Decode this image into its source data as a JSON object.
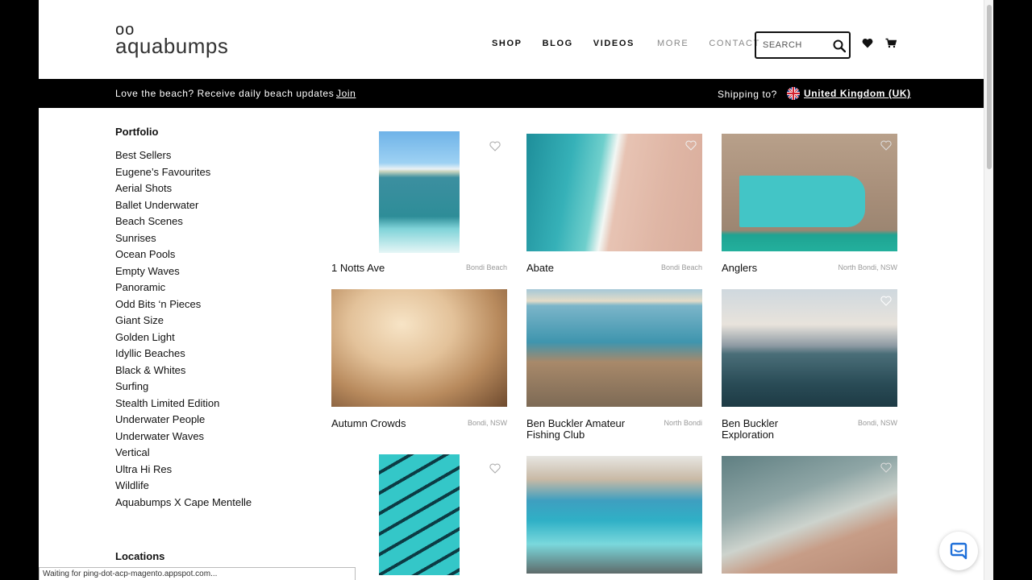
{
  "header": {
    "logo_dots": "oo",
    "logo_word": "aquabumps",
    "nav": [
      {
        "label": "SHOP",
        "style": "strong"
      },
      {
        "label": "BLOG",
        "style": "strong"
      },
      {
        "label": "VIDEOS",
        "style": "strong"
      },
      {
        "label": "MORE",
        "style": "light"
      },
      {
        "label": "CONTACT",
        "style": "light"
      }
    ],
    "search_placeholder": "SEARCH",
    "icons": [
      "search-icon",
      "heart-icon",
      "cart-icon"
    ]
  },
  "banner": {
    "promo": "Love the beach? Receive daily beach updates",
    "join": "Join",
    "shipping_label": "Shipping to?",
    "country": "United Kingdom (UK)"
  },
  "sidebar": {
    "portfolio_title": "Portfolio",
    "items": [
      "Best Sellers",
      "Eugene’s Favourites",
      "Aerial Shots",
      "Ballet Underwater",
      "Beach Scenes",
      "Sunrises",
      "Ocean Pools",
      "Empty Waves",
      "Panoramic",
      "Odd Bits ‘n Pieces",
      "Giant Size",
      "Golden Light",
      "Idyllic Beaches",
      "Black & Whites",
      "Surfing",
      "Stealth Limited Edition",
      "Underwater People",
      "Underwater Waves",
      "Vertical",
      "Ultra Hi Res",
      "Wildlife",
      "Aquabumps X Cape Mentelle"
    ],
    "locations_title": "Locations"
  },
  "products": [
    {
      "name": "1 Notts Ave",
      "location": "Bondi Beach"
    },
    {
      "name": "Abate",
      "location": "Bondi Beach"
    },
    {
      "name": "Anglers",
      "location": "North Bondi, NSW"
    },
    {
      "name": "Autumn Crowds",
      "location": "Bondi, NSW"
    },
    {
      "name": "Ben Buckler Amateur Fishing Club",
      "location": "North Bondi"
    },
    {
      "name": "Ben Buckler Exploration",
      "location": "Bondi, NSW"
    },
    {
      "name": "",
      "location": ""
    },
    {
      "name": "",
      "location": ""
    },
    {
      "name": "",
      "location": ""
    }
  ],
  "status_bar": "Waiting for ping-dot-acp-magento.appspot.com...",
  "colors": {
    "accent": "#000000",
    "banner_bg": "#000000",
    "chat_icon": "#1e6fd9"
  }
}
